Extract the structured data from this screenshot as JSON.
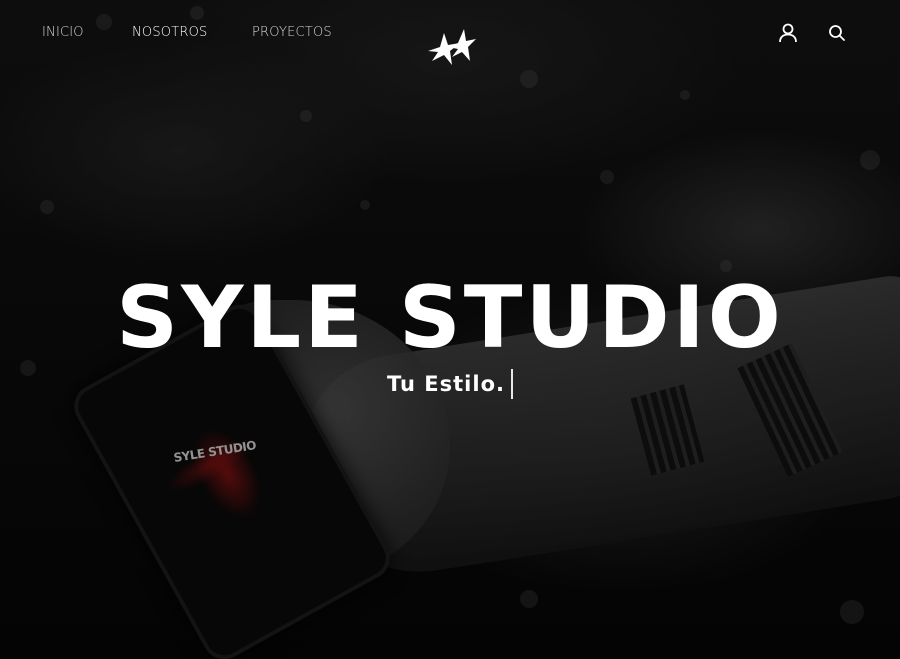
{
  "nav": {
    "items": [
      {
        "label": "INICIO",
        "active": false
      },
      {
        "label": "NOSOTROS",
        "active": true
      },
      {
        "label": "PROYECTOS",
        "active": false
      }
    ],
    "logo_icon": "double-star-logo-icon",
    "right_icons": [
      "user-icon",
      "search-icon"
    ]
  },
  "hero": {
    "title": "SYLE STUDIO",
    "tagline": "Tu Estilo.",
    "phone_screen_text": "SYLE STUDIO"
  },
  "colors": {
    "background": "#000000",
    "text": "#ffffff",
    "nav_text": "#d8d8d8",
    "accent_red": "#a01414"
  }
}
